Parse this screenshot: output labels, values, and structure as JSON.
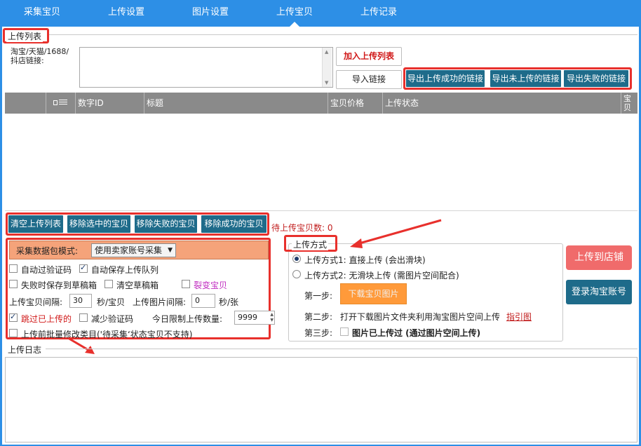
{
  "nav": {
    "tabs": [
      {
        "label": "采集宝贝"
      },
      {
        "label": "上传设置"
      },
      {
        "label": "图片设置"
      },
      {
        "label": "上传宝贝",
        "active": true
      },
      {
        "label": "上传记录"
      }
    ]
  },
  "upload_list": {
    "group_title": "上传列表",
    "url_label": "淘宝/天猫/1688/\n抖店链接:",
    "url_value": "",
    "add_button": "加入上传列表",
    "import_button": "导入链接",
    "export_success": "导出上传成功的链接",
    "export_not_uploaded": "导出未上传的链接",
    "export_failed": "导出失败的链接"
  },
  "table": {
    "select_all_icon": "select-all-icon",
    "columns": [
      "数字ID",
      "标题",
      "宝贝价格",
      "上传状态",
      "宝贝"
    ],
    "rows": []
  },
  "actions": {
    "clear": "清空上传列表",
    "remove_selected": "移除选中的宝贝",
    "remove_failed": "移除失败的宝贝",
    "remove_success": "移除成功的宝贝",
    "pending_count": "待上传宝贝数: 0"
  },
  "settings": {
    "mode_label": "采集数据包模式:",
    "mode_value": "使用卖家账号采集",
    "auto_captcha": "自动过验证码",
    "auto_save_queue": "自动保存上传队列",
    "save_draft_on_fail": "失败时保存到草稿箱",
    "clear_drafts": "清空草稿箱",
    "split_item": "裂变宝贝",
    "interval_label": "上传宝贝间隔:",
    "interval_value": "30",
    "interval_unit": "秒/宝贝",
    "img_interval_label": "上传图片间隔:",
    "img_interval_value": "0",
    "img_interval_unit": "秒/张",
    "skip_uploaded": "跳过已上传的",
    "reduce_captcha": "减少验证码",
    "daily_limit_label": "今日限制上传数量:",
    "daily_limit_value": "9999",
    "batch_modify": "上传前批量修改类目('待采集‘状态宝贝不支持)"
  },
  "upload_mode": {
    "group_title": "上传方式",
    "mode1": "上传方式1: 直接上传 (会出滑块)",
    "mode2": "上传方式2: 无滑块上传 (需图片空间配合)",
    "step1_label": "第一步:",
    "step1_button": "下载宝贝图片",
    "step2_label": "第二步:",
    "step2_text": "打开下载图片文件夹利用淘宝图片空间上传",
    "step2_link": "指引图",
    "step3_label": "第三步:",
    "step3_text": "图片已上传过 (通过图片空间上传)"
  },
  "buttons": {
    "upload_to_shop": "上传到店铺",
    "login_taobao": "登录淘宝账号"
  },
  "log": {
    "title": "上传日志",
    "content": ""
  },
  "colors": {
    "nav_blue": "#2d8fe6",
    "teal_button": "#1e6b8a",
    "highlight_red": "#e8302c",
    "header_gray": "#8a8a8a",
    "orange_mode": "#f5a37a",
    "orange_button": "#ff9a3a"
  }
}
